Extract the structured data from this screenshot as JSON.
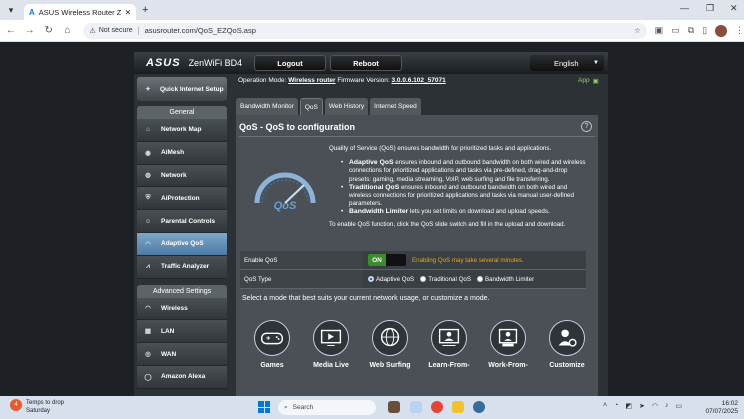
{
  "browser": {
    "tab_title": "ASUS Wireless Router ZenWiF...",
    "new_tab": "+",
    "url_badge": "Not secure",
    "url": "asusrouter.com/QoS_EZQoS.asp"
  },
  "router": {
    "logo": "ASUS",
    "model": "ZenWiFi BD4",
    "logout_label": "Logout",
    "reboot_label": "Reboot",
    "language": "English",
    "info": {
      "opmode_label": "Operation Mode:",
      "opmode_value": "Wireless router",
      "fw_label": "Firmware Version:",
      "fw_value": "3.0.0.6.102_57071",
      "app_label": "App"
    },
    "sidebar": {
      "quick_setup": "Quick Internet Setup",
      "general_header": "General",
      "general_items": [
        {
          "label": "Network Map",
          "icon": "network-map-icon"
        },
        {
          "label": "AiMesh",
          "icon": "aimesh-icon"
        },
        {
          "label": "Network",
          "icon": "network-icon"
        },
        {
          "label": "AiProtection",
          "icon": "shield-icon"
        },
        {
          "label": "Parental Controls",
          "icon": "parental-icon"
        },
        {
          "label": "Adaptive QoS",
          "icon": "qos-icon",
          "active": true
        },
        {
          "label": "Traffic Analyzer",
          "icon": "traffic-icon"
        }
      ],
      "advanced_header": "Advanced Settings",
      "advanced_items": [
        {
          "label": "Wireless",
          "icon": "wireless-icon"
        },
        {
          "label": "LAN",
          "icon": "lan-icon"
        },
        {
          "label": "WAN",
          "icon": "wan-icon"
        },
        {
          "label": "Amazon Alexa",
          "icon": "alexa-icon"
        }
      ]
    },
    "tabs": [
      "Bandwidth Monitor",
      "QoS",
      "Web History",
      "Internet Speed"
    ],
    "active_tab": "QoS",
    "content": {
      "title": "QoS - QoS to configuration",
      "gauge_text": "QoS",
      "intro": "Quality of Service (QoS) ensures bandwidth for prioritized tasks and applications.",
      "bullets": [
        {
          "title": "Adaptive QoS",
          "text": " ensures inbound and outbound bandwidth on both wired and wireless connections for prioritized applications and tasks via pre-defined, drag-and-drop presets: gaming, media streaming, VoIP, web surfing and file transferring."
        },
        {
          "title": "Traditional QoS",
          "text": " ensures inbound and outbound bandwidth on both wired and wireless connections for prioritized applications and tasks via manual user-defined parameters."
        },
        {
          "title": "Bandwidth Limiter",
          "text": " lets you set limits on download and upload speeds."
        }
      ],
      "enable_hint": "To enable QoS function, click the QoS slide switch and fill in the upload and download.",
      "enable_label": "Enable QoS",
      "toggle_on": "ON",
      "toggle_state": true,
      "warning": "Enabling QoS may take several minutes.",
      "type_label": "QoS Type",
      "types": [
        "Adaptive QoS",
        "Traditional QoS",
        "Bandwidth Limiter"
      ],
      "selected_type": "Adaptive QoS",
      "select_mode": "Select a mode that best suits your current network usage, or customize a mode.",
      "modes": [
        {
          "label": "Games",
          "icon": "gamepad-icon"
        },
        {
          "label": "Media Live",
          "icon": "media-icon"
        },
        {
          "label": "Web Surfing",
          "icon": "globe-icon"
        },
        {
          "label": "Learn-From-",
          "icon": "learn-icon"
        },
        {
          "label": "Work-From-",
          "icon": "work-icon"
        },
        {
          "label": "Customize",
          "icon": "customize-icon"
        }
      ]
    }
  },
  "taskbar": {
    "weather_badge": "4",
    "weather_line1": "Temps to drop",
    "weather_line2": "Saturday",
    "search": "Search",
    "time": "16:02",
    "date": "07/07/2025"
  }
}
